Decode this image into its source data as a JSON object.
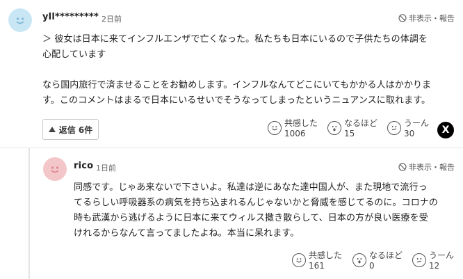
{
  "comment1": {
    "user": "yll*********",
    "time": "2日前",
    "report": "非表示・報告",
    "body": [
      "＞ 彼女は日本に来てインフルエンザで亡くなった。私たちも日本にいるので子供たちの体調を",
      "心配しています",
      "",
      "なら国内旅行で済ませることをお勧めします。インフルなんてどこにいてもかかる人はかかりま",
      "す。このコメントはまるで日本にいるせいでそうなってしまったというニュアンスに取れます。"
    ],
    "reply_button": "返信 6件",
    "reactions": [
      {
        "label": "共感した",
        "count": "1006",
        "icon": "smile-face-icon"
      },
      {
        "label": "なるほど",
        "count": "15",
        "icon": "surprised-face-icon"
      },
      {
        "label": "うーん",
        "count": "30",
        "icon": "hmm-face-icon"
      }
    ],
    "share": "X"
  },
  "comment2": {
    "user": "rico",
    "time": "1日前",
    "report": "非表示・報告",
    "body": [
      "同感です。じゃあ来ないで下さいよ。私達は逆にあなた達中国人が、また現地で流行っ",
      "てるらしい呼吸器系の病気を持ち込まれるんじゃないかと脅威を感じてるのに。コロナの",
      "時も武漢から逃げるように日本に来てウィルス撒き散らして、日本の方が良い医療を受",
      "けれるからなんて言ってましたよね。本当に呆れます。"
    ],
    "reactions": [
      {
        "label": "共感した",
        "count": "161",
        "icon": "smile-face-icon"
      },
      {
        "label": "なるほど",
        "count": "0",
        "icon": "surprised-face-icon"
      },
      {
        "label": "うーん",
        "count": "12",
        "icon": "hmm-face-icon"
      }
    ]
  }
}
